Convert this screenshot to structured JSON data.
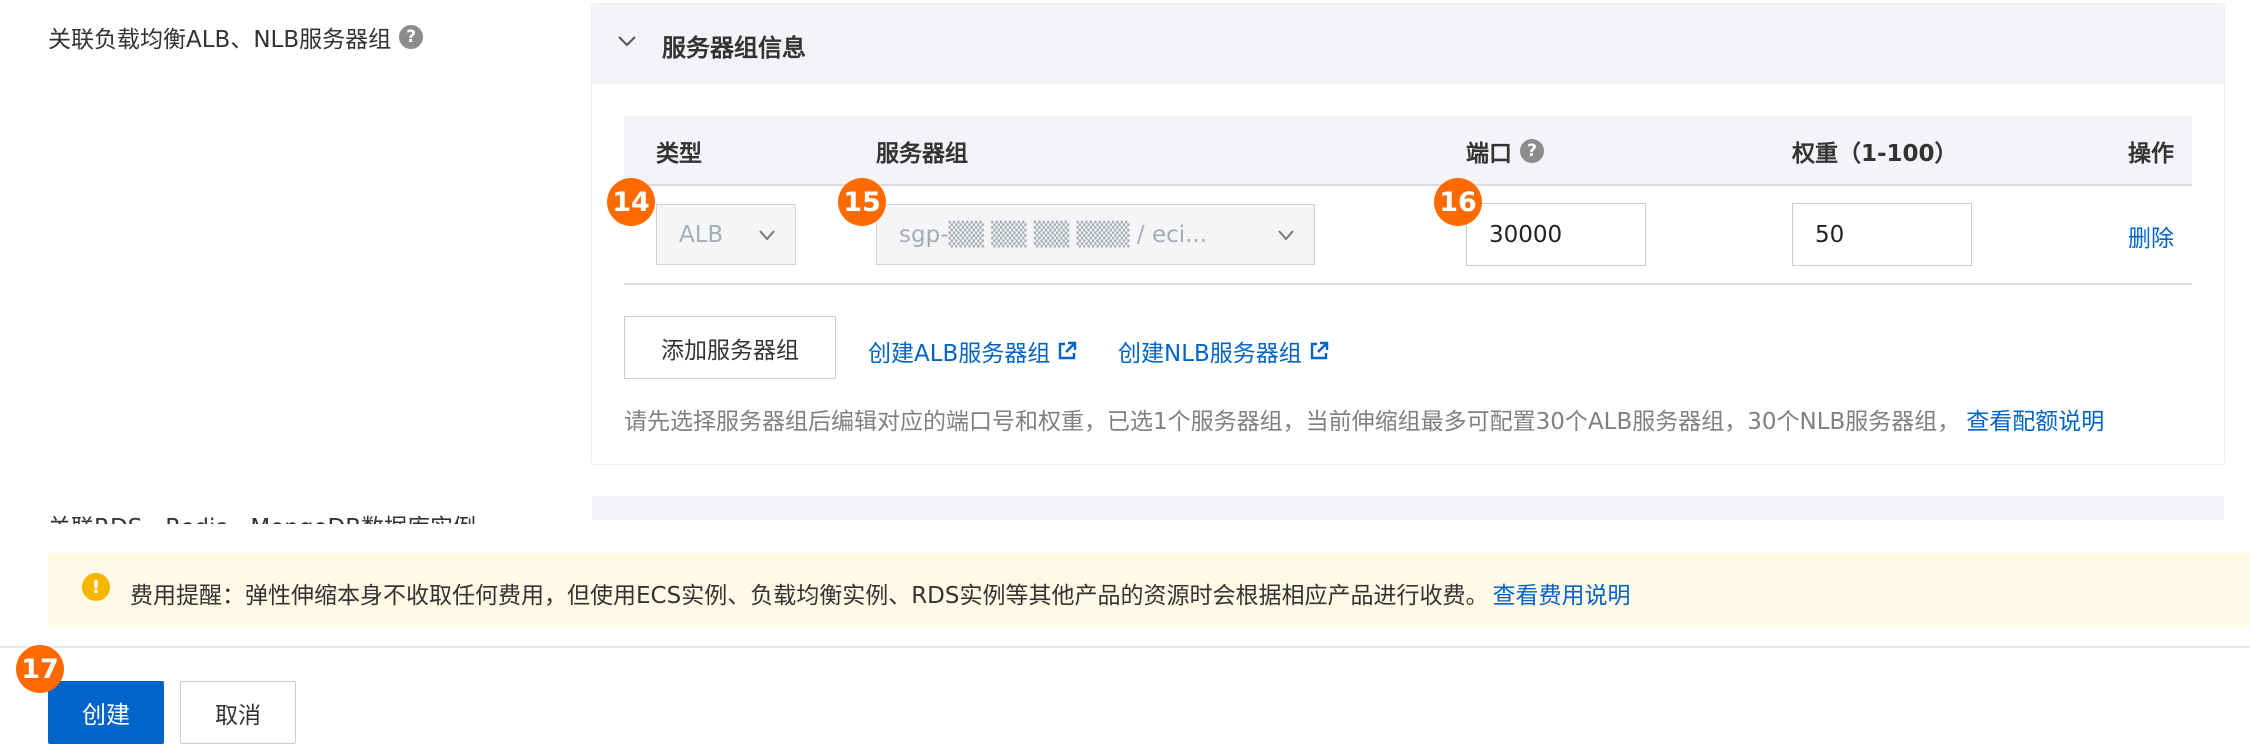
{
  "field": {
    "label": "关联负载均衡ALB、NLB服务器组",
    "help_glyph": "?"
  },
  "panel": {
    "title": "服务器组信息"
  },
  "table": {
    "headers": {
      "type": "类型",
      "server_group": "服务器组",
      "port": "端口",
      "weight": "权重（1-100）",
      "action": "操作"
    },
    "row": {
      "type_value": "ALB",
      "server_group_value": "sgp-▒▒  ▒▒ ▒▒ ▒▒▒ / eci...",
      "port_value": "30000",
      "weight_value": "50",
      "delete_label": "删除"
    }
  },
  "actions": {
    "add_group_label": "添加服务器组",
    "create_alb_label": "创建ALB服务器组",
    "create_nlb_label": "创建NLB服务器组"
  },
  "hint": {
    "text": "请先选择服务器组后编辑对应的端口号和权重，已选1个服务器组，当前伸缩组最多可配置30个ALB服务器组，30个NLB服务器组，",
    "link_label": "查看配额说明"
  },
  "cut_label": "关联RDS、Redis、MongoDB数据库实例",
  "notice": {
    "icon_glyph": "!",
    "text": "费用提醒：弹性伸缩本身不收取任何费用，但使用ECS实例、负载均衡实例、RDS实例等其他产品的资源时会根据相应产品进行收费。",
    "link_label": "查看费用说明"
  },
  "footer": {
    "create_label": "创建",
    "cancel_label": "取消"
  },
  "badges": [
    "14",
    "15",
    "16",
    "17"
  ],
  "colors": {
    "link": "#0064c8",
    "primary": "#0064c8",
    "badge": "#ff6a00",
    "notice_bg": "#fff9e6",
    "warn": "#f5b700"
  }
}
